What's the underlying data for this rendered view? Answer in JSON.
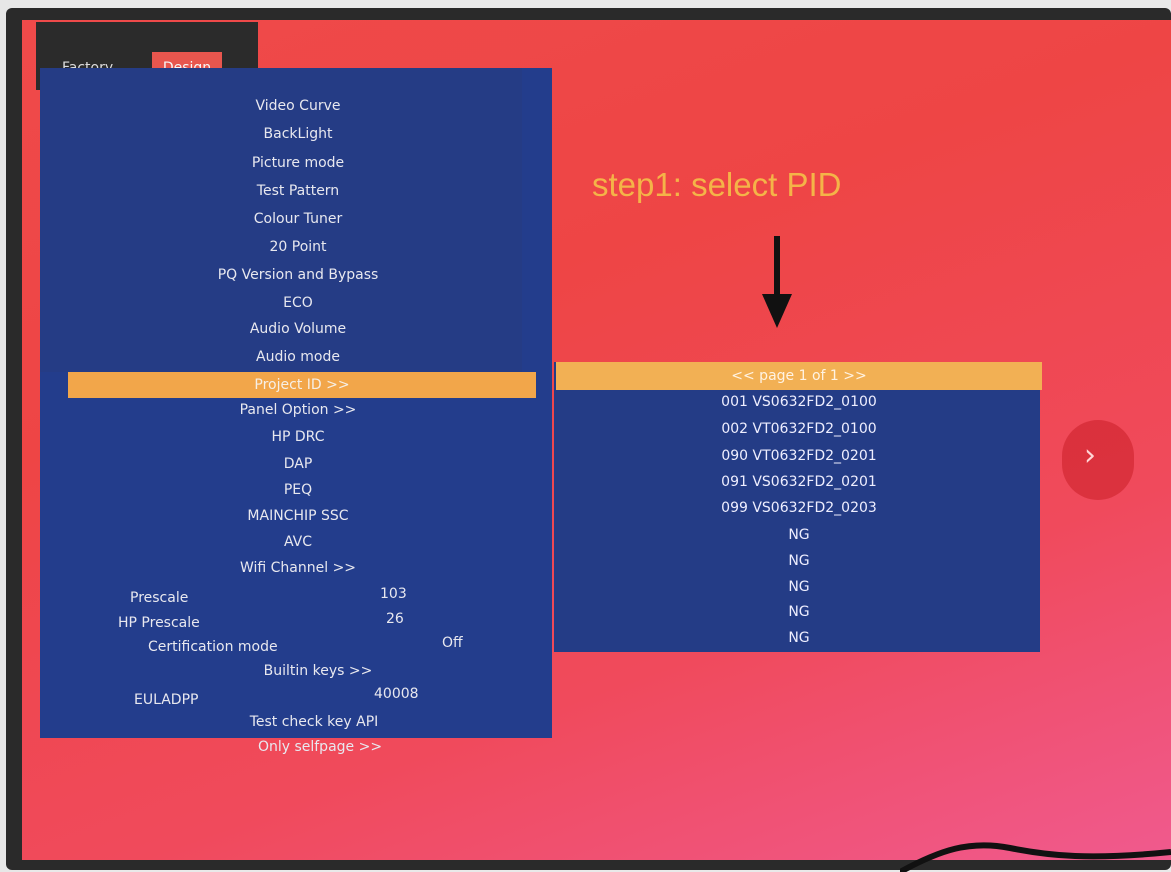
{
  "tabs": {
    "factory": "Factory",
    "design": "Design"
  },
  "menu_items": [
    "Video Curve",
    "BackLight",
    "Picture mode",
    "Test Pattern",
    "Colour Tuner",
    "20 Point",
    "PQ Version and Bypass",
    "ECO",
    "Audio Volume",
    "Audio mode",
    "Project ID >>",
    "Panel Option >>",
    "HP DRC",
    "DAP",
    "PEQ",
    "MAINCHIP SSC",
    "AVC",
    "Wifi Channel >>"
  ],
  "settings": {
    "prescale": {
      "label": "Prescale",
      "value": "103"
    },
    "hp_prescale": {
      "label": "HP Prescale",
      "value": "26"
    },
    "certification_mode": {
      "label": "Certification mode",
      "value": "Off"
    },
    "builtin_keys": "Builtin keys >>",
    "euladpp": {
      "label": "EULADPP",
      "value": "40008"
    },
    "test_check_key_api": "Test check key API",
    "only_selfpage": "Only selfpage >>"
  },
  "pid_panel": {
    "header": "<< page 1 of 1 >>",
    "items": [
      "001 VS0632FD2_0100",
      "002 VT0632FD2_0100",
      "090 VT0632FD2_0201",
      "091 VS0632FD2_0201",
      "099 VS0632FD2_0203",
      "NG",
      "NG",
      "NG",
      "NG",
      "NG"
    ]
  },
  "annotation": "step1: select PID",
  "next_icon": "chevron-right-icon",
  "colors": {
    "menu_bg": "#233d8c",
    "highlight": "#f2a64a",
    "screen": "#ef4a4a",
    "annotation": "#f4b448"
  }
}
